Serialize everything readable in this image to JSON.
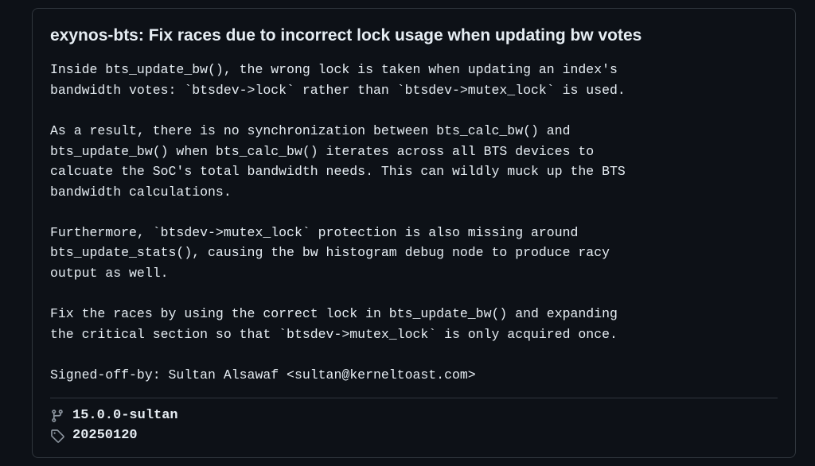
{
  "commit": {
    "title": "exynos-bts: Fix races due to incorrect lock usage when updating bw votes",
    "body": "Inside bts_update_bw(), the wrong lock is taken when updating an index's\nbandwidth votes: `btsdev->lock` rather than `btsdev->mutex_lock` is used.\n\nAs a result, there is no synchronization between bts_calc_bw() and\nbts_update_bw() when bts_calc_bw() iterates across all BTS devices to\ncalcuate the SoC's total bandwidth needs. This can wildly muck up the BTS\nbandwidth calculations.\n\nFurthermore, `btsdev->mutex_lock` protection is also missing around\nbts_update_stats(), causing the bw histogram debug node to produce racy\noutput as well.\n\nFix the races by using the correct lock in bts_update_bw() and expanding\nthe critical section so that `btsdev->mutex_lock` is only acquired once.\n\nSigned-off-by: Sultan Alsawaf <sultan@kerneltoast.com>"
  },
  "refs": {
    "branch": "15.0.0-sultan",
    "tag": "20250120"
  }
}
